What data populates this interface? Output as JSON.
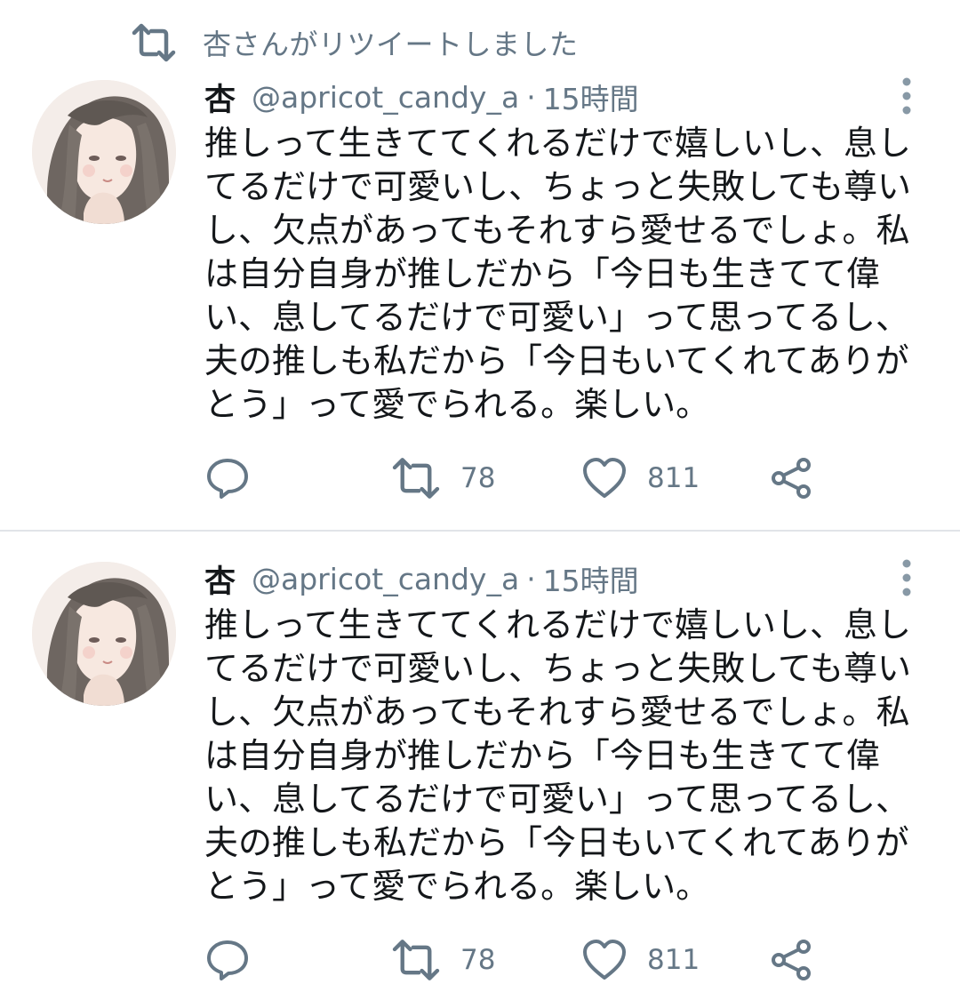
{
  "retweet_label": "杏さんがリツイートしました",
  "tweets": [
    {
      "name": "杏",
      "handle": "@apricot_candy_a",
      "separator": "·",
      "time": "15時間",
      "lines": [
        "推しって生きててくれるだけで嬉しいし、息し",
        "てるだけで可愛いし、ちょっと失敗しても尊い",
        "し、欠点があってもそれすら愛せるでしょ。私",
        "は自分自身が推しだから「今日も生きてて偉",
        "い、息してるだけで可愛い」って思ってるし、",
        "夫の推しも私だから「今日もいてくれてありが",
        "とう」って愛でられる。楽しい。"
      ],
      "retweets": "78",
      "likes": "811"
    },
    {
      "name": "杏",
      "handle": "@apricot_candy_a",
      "separator": "·",
      "time": "15時間",
      "lines": [
        "推しって生きててくれるだけで嬉しいし、息し",
        "てるだけで可愛いし、ちょっと失敗しても尊い",
        "し、欠点があってもそれすら愛せるでしょ。私",
        "は自分自身が推しだから「今日も生きてて偉",
        "い、息してるだけで可愛い」って思ってるし、",
        "夫の推しも私だから「今日もいてくれてありが",
        "とう」って愛でられる。楽しい。"
      ],
      "retweets": "78",
      "likes": "811"
    }
  ],
  "icons": {
    "retweet_context": "retweet-icon",
    "more": "more-vertical-icon",
    "reply": "reply-icon",
    "retweet": "retweet-icon",
    "like": "heart-icon",
    "share": "share-icon"
  },
  "colors": {
    "text": "#14171a",
    "secondary": "#657786",
    "icon": "#657786",
    "divider": "#e1e4e8"
  }
}
